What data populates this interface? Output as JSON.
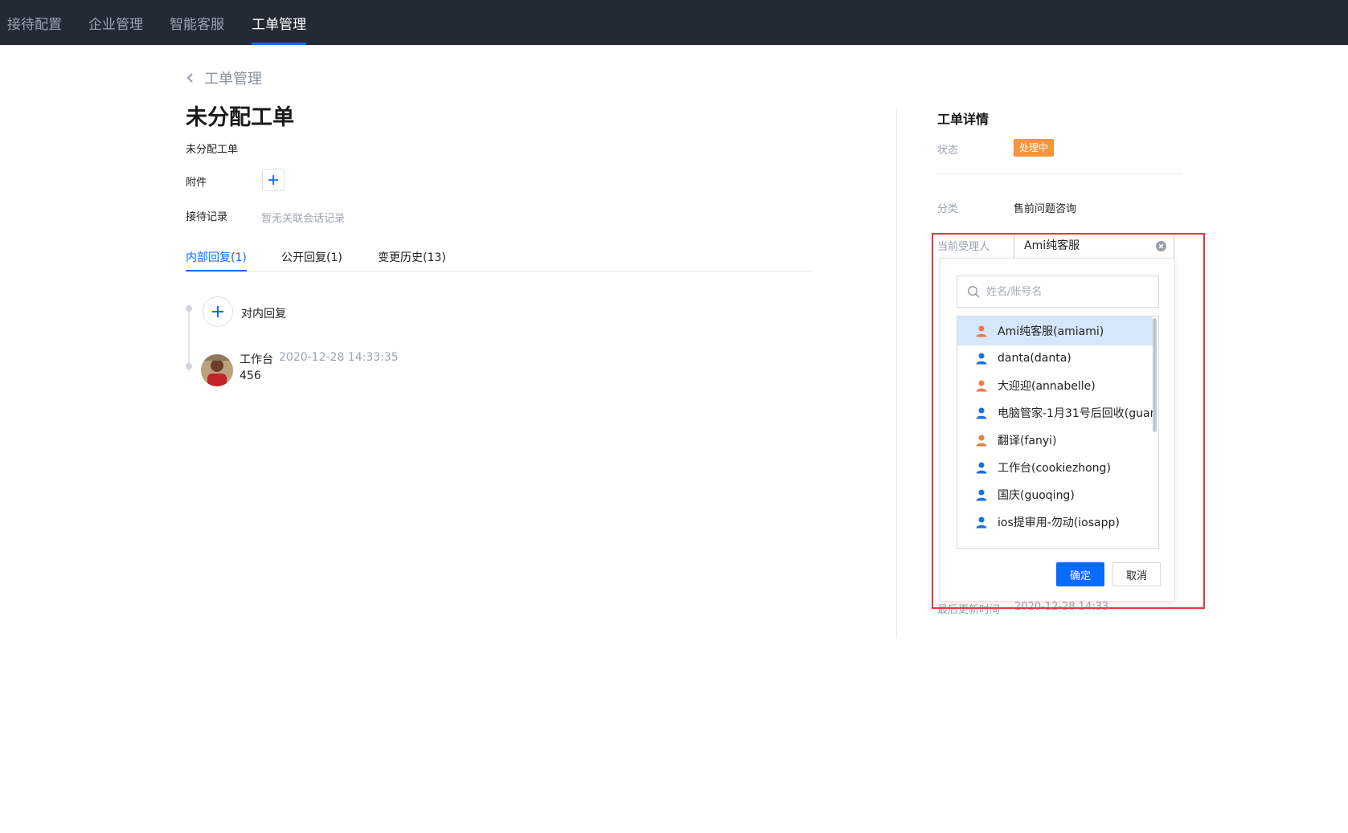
{
  "topnav": [
    {
      "label": "接待配置",
      "active": false
    },
    {
      "label": "企业管理",
      "active": false
    },
    {
      "label": "智能客服",
      "active": false
    },
    {
      "label": "工单管理",
      "active": true
    }
  ],
  "breadcrumb": {
    "back_label": "工单管理"
  },
  "ticket": {
    "title": "未分配工单",
    "description": "未分配工单",
    "attachment_label": "附件",
    "record_label": "接待记录",
    "record_empty": "暂无关联会话记录"
  },
  "tabs": [
    {
      "label": "内部回复(1)",
      "active": true
    },
    {
      "label": "公开回复(1)",
      "active": false
    },
    {
      "label": "变更历史(13)",
      "active": false
    }
  ],
  "reply": {
    "add_label": "对内回复"
  },
  "messages": [
    {
      "author": "工作台",
      "time": "2020-12-28 14:33:35",
      "body": "456"
    }
  ],
  "detail": {
    "title": "工单详情",
    "status_label": "状态",
    "status_value": "处理中",
    "status_color": "#f6953a",
    "category_label": "分类",
    "category_value": "售前问题咨询",
    "assignee_label": "当前受理人",
    "assignee_value": "Ami纯客服",
    "updated_label": "最后更新时间",
    "updated_value": "2020-12-28 14:33"
  },
  "assignee_dropdown": {
    "search_placeholder": "姓名/账号名",
    "options": [
      {
        "label": "Ami纯客服(amiami)",
        "icon": "user-orange-icon",
        "color": "#ef7a4a",
        "selected": true
      },
      {
        "label": "danta(danta)",
        "icon": "user-blue-icon",
        "color": "#1f6fe0",
        "selected": false
      },
      {
        "label": "大迎迎(annabelle)",
        "icon": "user-orange-icon",
        "color": "#ef7a4a",
        "selected": false
      },
      {
        "label": "电脑管家-1月31号后回收(guan",
        "icon": "user-blue-icon",
        "color": "#1f6fe0",
        "selected": false
      },
      {
        "label": "翻译(fanyi)",
        "icon": "user-orange-icon",
        "color": "#ef7a4a",
        "selected": false
      },
      {
        "label": "工作台(cookiezhong)",
        "icon": "user-blue-icon",
        "color": "#1f6fe0",
        "selected": false
      },
      {
        "label": "国庆(guoqing)",
        "icon": "user-blue-icon",
        "color": "#1f6fe0",
        "selected": false
      },
      {
        "label": "ios提审用-勿动(iosapp)",
        "icon": "user-blue-icon",
        "color": "#1f6fe0",
        "selected": false
      }
    ],
    "confirm_label": "确定",
    "cancel_label": "取消"
  },
  "colors": {
    "accent": "#0a6cff",
    "topbar": "#222a36",
    "highlight_box": "#e8383d"
  }
}
